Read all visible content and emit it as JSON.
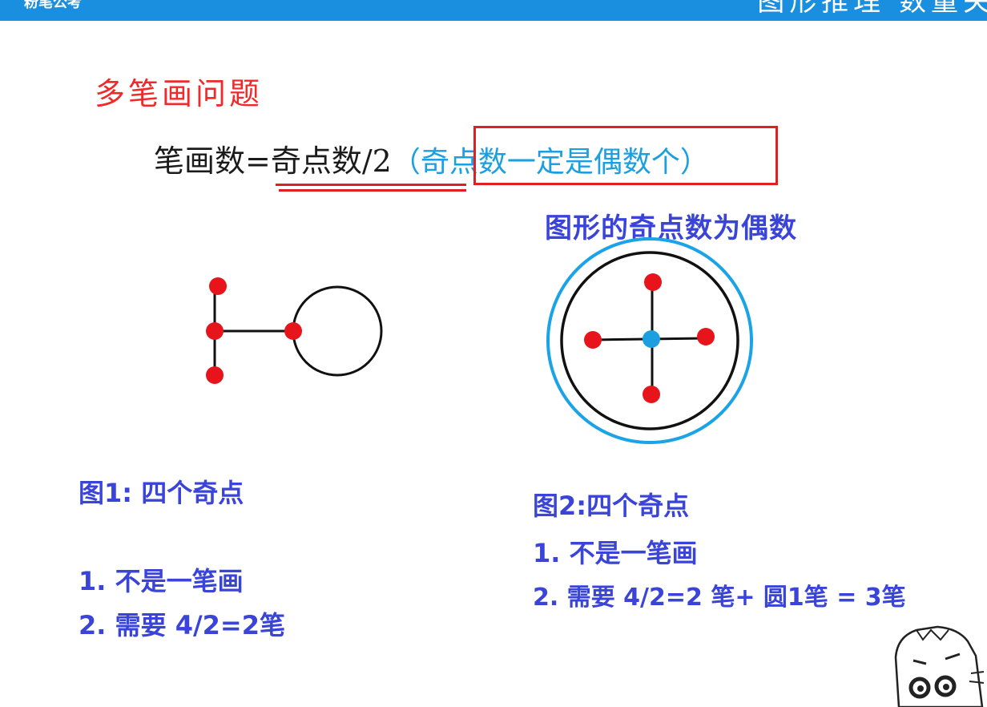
{
  "header": {
    "brand": "粉笔公考",
    "title": "图形推理 数量关"
  },
  "section_title": "多笔画问题",
  "formula": {
    "main": "笔画数=奇点数/2",
    "note": "（奇点数一定是偶数个）"
  },
  "caption_right": "图形的奇点数为偶数",
  "figure1": {
    "label": "图1: 四个奇点",
    "points": [
      "1. 不是一笔画",
      "2. 需要 4/2=2笔"
    ]
  },
  "figure2": {
    "label": "图2:四个奇点",
    "points": [
      "1. 不是一笔画",
      "2. 需要 4/2=2 笔+ 圆1笔 = 3笔"
    ]
  },
  "colors": {
    "header_bg": "#1a8fe0",
    "title_red": "#f02a2a",
    "note_blue": "#1a9fe0",
    "text_blue": "#3a44d8",
    "odd_point": "#e8141c",
    "center_point": "#1a9fe0",
    "outer_ring": "#1ba3e8"
  }
}
